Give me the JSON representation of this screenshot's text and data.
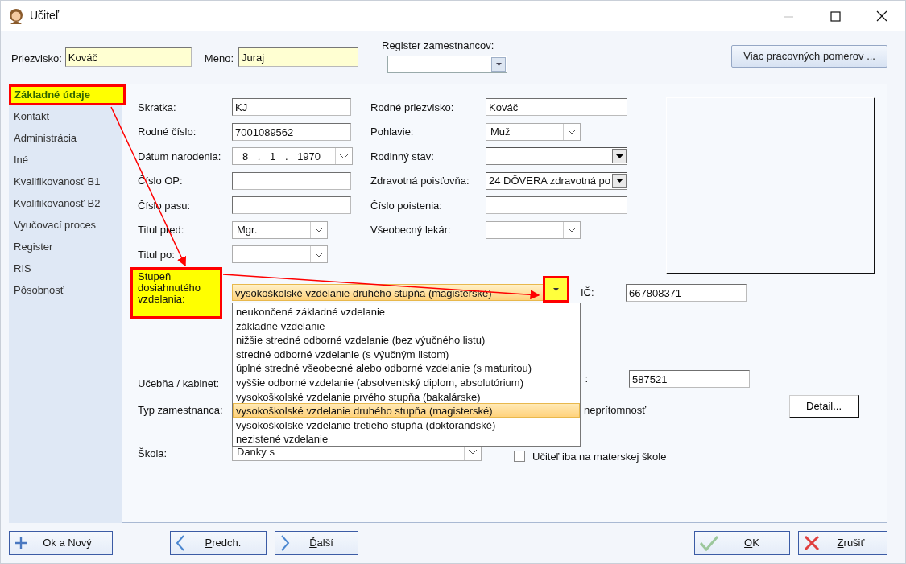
{
  "window": {
    "title": "Učiteľ"
  },
  "header": {
    "surname": {
      "label": "Priezvisko:",
      "value": "Kováč"
    },
    "first_name": {
      "label": "Meno:",
      "value": "Juraj"
    },
    "register": {
      "label": "Register zamestnancov:"
    },
    "button": "Viac pracovných pomerov ..."
  },
  "sidebar": {
    "items": [
      {
        "label": "Základné údaje",
        "selected": true
      },
      {
        "label": "Kontakt",
        "selected": false
      },
      {
        "label": "Administrácia",
        "selected": false
      },
      {
        "label": "Iné",
        "selected": false
      },
      {
        "label": "Kvalifikovanosť B1",
        "selected": false
      },
      {
        "label": "Kvalifikovanosť B2",
        "selected": false
      },
      {
        "label": "Vyučovací proces",
        "selected": false
      },
      {
        "label": "Register",
        "selected": false
      },
      {
        "label": "RIS",
        "selected": false
      },
      {
        "label": "Pôsobnosť",
        "selected": false
      }
    ]
  },
  "form": {
    "left_fields": [
      {
        "label": "Skratka:",
        "kind": "text",
        "value": "KJ"
      },
      {
        "label": "Rodné číslo:",
        "kind": "text",
        "value": "7001089562"
      },
      {
        "label": "Dátum narodenia:",
        "kind": "date",
        "value": "8 . 1 . 1970"
      },
      {
        "label": "Číslo OP:",
        "kind": "text"
      },
      {
        "label": "Číslo pasu:",
        "kind": "text"
      },
      {
        "label": "Titul pred:",
        "kind": "combo",
        "value": "Mgr."
      },
      {
        "label": "Titul po:",
        "kind": "combo"
      }
    ],
    "right_fields": [
      {
        "label": "Rodné priezvisko:",
        "kind": "text",
        "value": "Kováč"
      },
      {
        "label": "Pohlavie:",
        "kind": "combo",
        "value": "Muž"
      },
      {
        "label": "Rodinný stav:",
        "kind": "dropdown"
      },
      {
        "label": "Zdravotná poisťovňa:",
        "kind": "dropdown",
        "value": "24 DÔVERA zdravotná po"
      },
      {
        "label": "Číslo poistenia:",
        "kind": "text"
      },
      {
        "label": "Všeobecný lekár:",
        "kind": "combo"
      }
    ],
    "education": {
      "label": "Stupeň dosiahnutého vzdelania:",
      "label_highlighted": true,
      "button_highlighted": true,
      "value": "vysokoškolské vzdelanie druhého stupňa (magisterské)",
      "expanded": true,
      "options": [
        {
          "label": "neukončené základné vzdelanie",
          "selected": false
        },
        {
          "label": "základné vzdelanie",
          "selected": false
        },
        {
          "label": "nižšie stredné odborné vzdelanie (bez výučného listu)",
          "selected": false
        },
        {
          "label": "stredné odborné vzdelanie (s výučným listom)",
          "selected": false
        },
        {
          "label": "úplné stredné všeobecné alebo odborné vzdelanie (s maturitou)",
          "selected": false
        },
        {
          "label": "vyššie odborné vzdelanie (absolventský diplom, absolutórium)",
          "selected": false
        },
        {
          "label": "vysokoškolské vzdelanie prvého stupňa (bakalárske)",
          "selected": false
        },
        {
          "label": "vysokoškolské vzdelanie druhého stupňa (magisterské)",
          "selected": true
        },
        {
          "label": "vysokoškolské vzdelanie tretieho stupňa (doktorandské)",
          "selected": false
        },
        {
          "label": "nezistené vzdelanie",
          "selected": false
        }
      ]
    },
    "ic": {
      "label": "IČ:",
      "value": "667808371"
    },
    "room": {
      "label": "Učebňa / kabinet:"
    },
    "room_code": {
      "label": ":",
      "value": "587521"
    },
    "employee_type": {
      "label": "Typ zamestnanca:"
    },
    "absence": {
      "label": "neprítomnosť"
    },
    "detail_button": "Detail...",
    "school": {
      "label": "Škola:",
      "value": "Danky s"
    },
    "kindergarten": {
      "label": "Učiteľ iba na materskej škole",
      "checked": false
    }
  },
  "footer": {
    "buttons": [
      {
        "label": "Ok a Nový",
        "kind": "plus",
        "first_letter_underlined": false
      },
      {
        "label": "Predch.",
        "kind": "prev",
        "first_letter_underlined": true
      },
      {
        "label": "Ďalší",
        "kind": "next",
        "first_letter_underlined": true
      },
      {
        "label": "OK",
        "kind": "ok",
        "first_letter_underlined": true
      },
      {
        "label": "Zrušiť",
        "kind": "cancel",
        "first_letter_underlined": true
      }
    ]
  }
}
